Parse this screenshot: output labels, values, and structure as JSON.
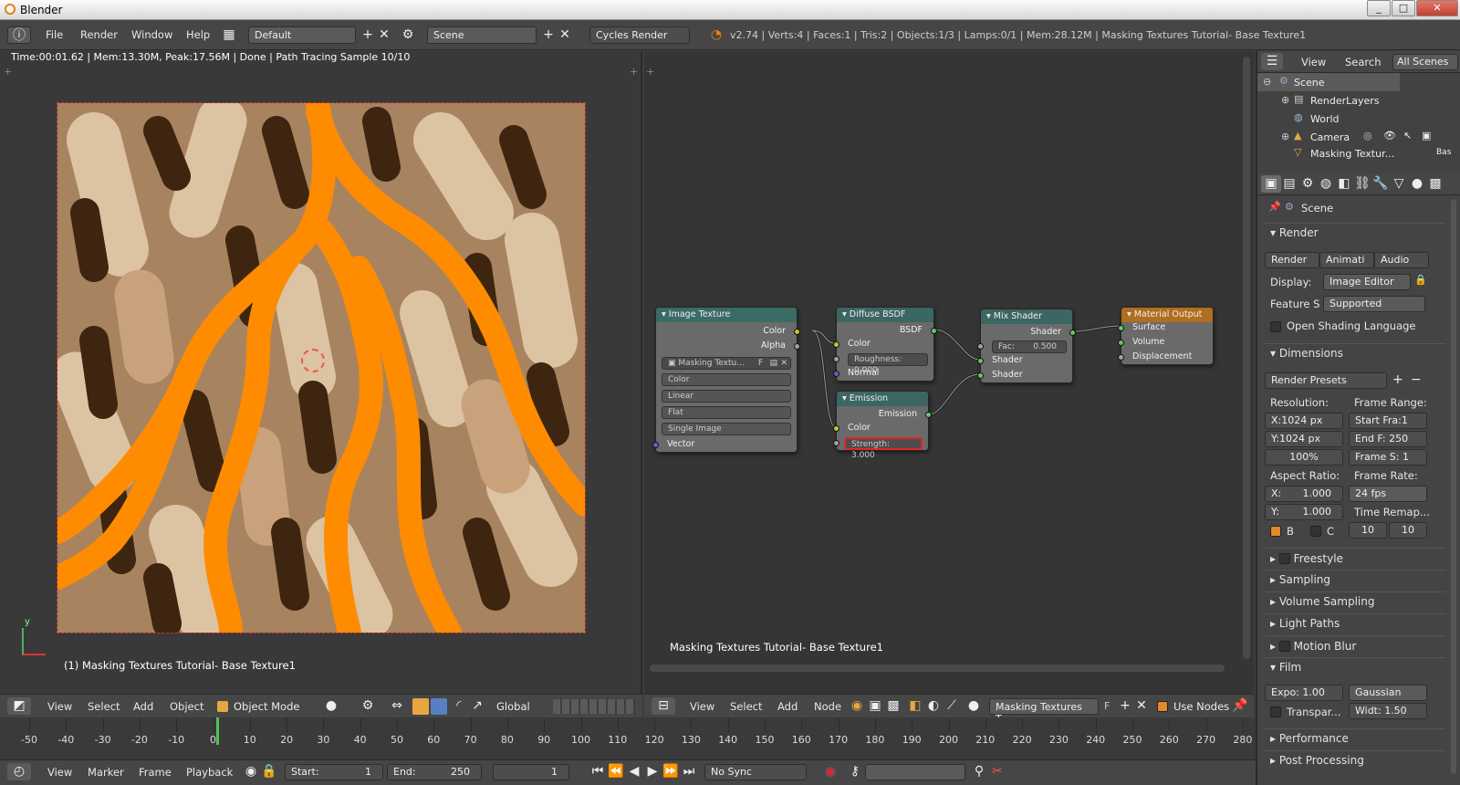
{
  "window": {
    "title": "Blender",
    "minimize": "0",
    "maximize": "1",
    "close": "r"
  },
  "infobar": {
    "menus": [
      "File",
      "Render",
      "Window",
      "Help"
    ],
    "layout": "Default",
    "scene": "Scene",
    "engine": "Cycles Render",
    "stats": "v2.74 | Verts:4 | Faces:1 | Tris:2 | Objects:1/3 | Lamps:0/1 | Mem:28.12M | Masking Textures Tutorial- Base Texture1"
  },
  "viewport": {
    "render_info": "Time:00:01.62 | Mem:13.30M, Peak:17.56M | Done | Path Tracing Sample 10/10",
    "object_label": "(1) Masking Textures Tutorial- Base Texture1",
    "axis_y": "y",
    "header": {
      "menus": [
        "View",
        "Select",
        "Add",
        "Object"
      ],
      "mode": "Object Mode",
      "orientation": "Global"
    }
  },
  "node_editor": {
    "material_label": "Masking Textures Tutorial- Base Texture1",
    "header": {
      "menus": [
        "View",
        "Select",
        "Add",
        "Node"
      ],
      "material": "Masking Textures T...",
      "fake_user": "F",
      "use_nodes_label": "Use Nodes"
    },
    "nodes": {
      "image_texture": {
        "title": "Image Texture",
        "out_color": "Color",
        "out_alpha": "Alpha",
        "image": "Masking Textu...",
        "image_f": "F",
        "color_space": "Color",
        "interpolation": "Linear",
        "projection": "Flat",
        "source": "Single Image",
        "in_vector": "Vector"
      },
      "diffuse": {
        "title": "Diffuse BSDF",
        "out_bsdf": "BSDF",
        "in_color": "Color",
        "roughness": "Roughness:  0.000",
        "in_normal": "Normal"
      },
      "emission": {
        "title": "Emission",
        "out_emission": "Emission",
        "in_color": "Color",
        "strength": "Strength:  3.000"
      },
      "mix": {
        "title": "Mix Shader",
        "out_shader": "Shader",
        "fac_label": "Fac:",
        "fac_value": "0.500",
        "in_shader1": "Shader",
        "in_shader2": "Shader"
      },
      "output": {
        "title": "Material Output",
        "surface": "Surface",
        "volume": "Volume",
        "displacement": "Displacement"
      }
    }
  },
  "outliner": {
    "header": {
      "view": "View",
      "search": "Search",
      "filter": "All Scenes"
    },
    "items": [
      "Scene",
      "RenderLayers",
      "World",
      "Camera",
      "Masking Textur..."
    ],
    "extra": "Bas"
  },
  "properties": {
    "context": "Scene",
    "render_panel": "Render",
    "render_buttons": [
      "Render",
      "Animati",
      "Audio"
    ],
    "display_label": "Display:",
    "display_value": "Image Editor",
    "feature_label": "Feature S",
    "feature_value": "Supported",
    "osl_label": "Open Shading Language",
    "dimensions_panel": "Dimensions",
    "render_presets": "Render Presets",
    "resolution_label": "Resolution:",
    "res_x": "X:1024 px",
    "res_y": "Y:1024 px",
    "res_pct": "100%",
    "frame_range_label": "Frame Range:",
    "start_frame": "Start Fra:1",
    "end_frame": "End F: 250",
    "frame_step": "Frame S: 1",
    "aspect_label": "Aspect Ratio:",
    "aspect_x_label": "X:",
    "aspect_x": "1.000",
    "aspect_y_label": "Y:",
    "aspect_y": "1.000",
    "frame_rate_label": "Frame Rate:",
    "fps": "24 fps",
    "time_remap": "Time Remap...",
    "border_label": "B",
    "crop_label": "C",
    "remap_old": "10",
    "remap_new": "10",
    "panels": [
      "Freestyle",
      "Sampling",
      "Volume Sampling",
      "Light Paths",
      "Motion Blur"
    ],
    "film_panel": "Film",
    "exposure": "Expo: 1.00",
    "filter": "Gaussian",
    "transparent": "Transpar...",
    "filter_width": "Widt: 1.50",
    "panels_bottom": [
      "Performance",
      "Post Processing"
    ]
  },
  "timeline": {
    "ticks": [
      "-50",
      "-40",
      "-30",
      "-20",
      "-10",
      "0",
      "10",
      "20",
      "30",
      "40",
      "50",
      "60",
      "70",
      "80",
      "90",
      "100",
      "110",
      "120",
      "130",
      "140",
      "150",
      "160",
      "170",
      "180",
      "190",
      "200",
      "210",
      "220",
      "230",
      "240",
      "250",
      "260",
      "270",
      "280"
    ],
    "current_frame_value": 1,
    "menus": [
      "View",
      "Marker",
      "Frame",
      "Playback"
    ],
    "start_label": "Start:",
    "start_value": "1",
    "end_label": "End:",
    "end_value": "250",
    "current": "1",
    "sync": "No Sync"
  },
  "colors": {
    "accent": "#f7931e",
    "node_shader_header": "#3c6662",
    "node_output_header": "#b06e1e",
    "highlight_red": "#e02828"
  }
}
